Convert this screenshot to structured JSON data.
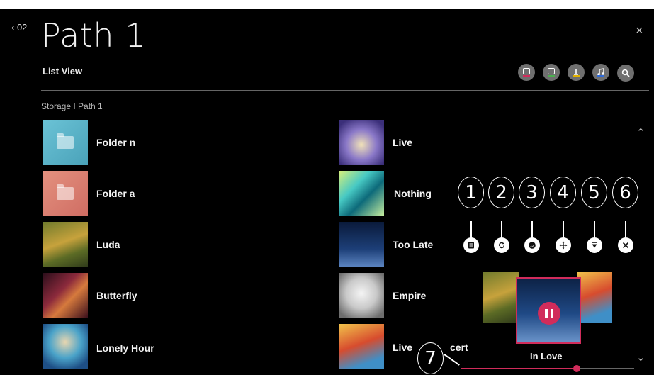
{
  "header": {
    "back_label": "‹ 02",
    "title": "Path 1",
    "subtitle": "List View",
    "close_icon": "×"
  },
  "breadcrumb": "Storage  I  Path 1",
  "toolbar": {
    "buttons": [
      {
        "icon": "media-icon",
        "accent": "#d12c5b"
      },
      {
        "icon": "trash-icon",
        "accent": "#4caf50"
      },
      {
        "icon": "sort-icon",
        "accent": "#e2b100"
      },
      {
        "icon": "music-icon",
        "accent": "#2f6bd8"
      },
      {
        "icon": "search-icon",
        "accent": null
      }
    ]
  },
  "left_list": [
    {
      "label": "Folder n",
      "type": "folder",
      "color": "#5fb3c9"
    },
    {
      "label": "Folder a",
      "type": "folder",
      "color": "#dc8073"
    },
    {
      "label": "Luda",
      "type": "image"
    },
    {
      "label": "Butterfly",
      "type": "image"
    },
    {
      "label": "Lonely Hour",
      "type": "image"
    }
  ],
  "right_list": [
    {
      "label": "Live"
    },
    {
      "label": "Nothing"
    },
    {
      "label": "Too Late"
    },
    {
      "label": "Empire"
    },
    {
      "label": "Live",
      "label_tail": "cert"
    }
  ],
  "player_controls": [
    {
      "number": "1",
      "icon": "playlist-icon"
    },
    {
      "number": "2",
      "icon": "repeat-icon"
    },
    {
      "number": "3",
      "icon": "sleep-icon"
    },
    {
      "number": "4",
      "icon": "move-icon"
    },
    {
      "number": "5",
      "icon": "minimize-icon"
    },
    {
      "number": "6",
      "icon": "close-icon"
    }
  ],
  "callout_7": "7",
  "now_playing": {
    "title": "In Love",
    "progress": 0.67
  },
  "scroll": {
    "up": "⌃",
    "down": "⌄"
  },
  "colors": {
    "accent": "#d12c5b",
    "background": "#000000"
  }
}
